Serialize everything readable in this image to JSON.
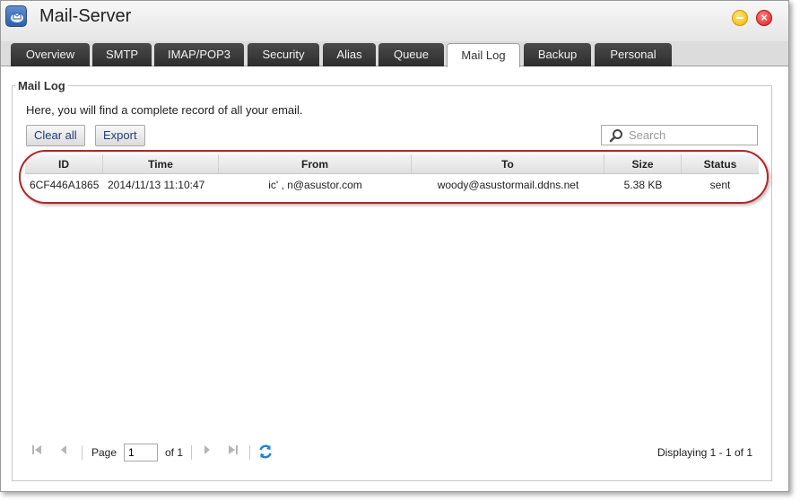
{
  "app": {
    "title": "Mail-Server"
  },
  "tabs": [
    {
      "label": "Overview"
    },
    {
      "label": "SMTP"
    },
    {
      "label": "IMAP/POP3"
    },
    {
      "label": "Security"
    },
    {
      "label": "Alias"
    },
    {
      "label": "Queue"
    },
    {
      "label": "Mail Log",
      "active": true
    },
    {
      "label": "Backup"
    },
    {
      "label": "Personal"
    }
  ],
  "panel": {
    "legend": "Mail Log",
    "description": "Here, you will find a complete record of all your email."
  },
  "toolbar": {
    "clear_label": "Clear all",
    "export_label": "Export",
    "search_placeholder": "Search"
  },
  "grid": {
    "columns": [
      "ID",
      "Time",
      "From",
      "To",
      "Size",
      "Status"
    ],
    "rows": [
      {
        "id": "6CF446A1865",
        "time": "2014/11/13 11:10:47",
        "from": "ic'  ,  n@asustor.com",
        "to": "woody@asustormail.ddns.net",
        "size": "5.38 KB",
        "status": "sent"
      }
    ]
  },
  "pager": {
    "page_label": "Page",
    "page_value": "1",
    "of_label": "of 1",
    "display": "Displaying 1 - 1 of 1"
  },
  "colors": {
    "highlight_ring": "#b3262b",
    "refresh_icon": "#1a7fd4",
    "tab_dark": "#2d2d2d"
  }
}
